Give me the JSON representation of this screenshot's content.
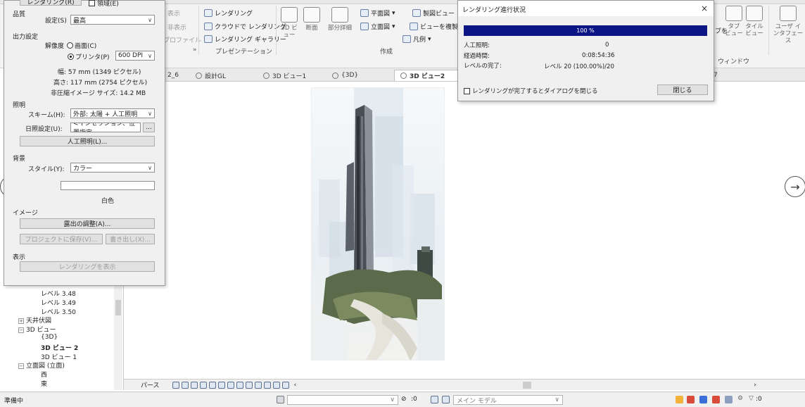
{
  "ribbon": {
    "items": [
      {
        "label": "レンダリング",
        "id": "rendering"
      },
      {
        "label": "クラウドで レンダリング",
        "id": "cloud-rendering"
      },
      {
        "label": "レンダリング ギャラリー",
        "id": "rendering-gallery"
      },
      {
        "label": "平面図",
        "id": "floor-plan"
      },
      {
        "label": "立面図",
        "id": "elevation"
      },
      {
        "label": "製図ビュー",
        "id": "drafting-view"
      },
      {
        "label": "ビューを複製",
        "id": "duplicate-view"
      },
      {
        "label": "凡例",
        "id": "legend"
      },
      {
        "label": "表示",
        "id": "show-dim"
      },
      {
        "label": "非表示",
        "id": "hide-dim"
      },
      {
        "label": "プロファイル",
        "id": "profile-dim"
      }
    ],
    "big_buttons": [
      {
        "label": "3D ビュー",
        "id": "3d-view"
      },
      {
        "label": "断面",
        "id": "section"
      },
      {
        "label": "部分詳細",
        "id": "callout"
      },
      {
        "label": "タブ ビュー",
        "id": "tab-views"
      },
      {
        "label": "タイル ビュー",
        "id": "tile-views"
      },
      {
        "label": "ユーザ インタフェース",
        "id": "user-interface"
      }
    ],
    "panels": {
      "presentation": "プレゼンテーション",
      "create": "作成",
      "window": "ウィンドウ"
    },
    "partial_left": "ブを"
  },
  "render_dialog": {
    "top_button": "レンダリング(R)",
    "region_checkbox": "領域(E)",
    "quality_group": "品質",
    "quality_label": "設定(S)",
    "quality_value": "最高",
    "output_group": "出力設定",
    "resolution_label": "解像度",
    "screen_option": "画面(C)",
    "printer_option": "プリンタ(P)",
    "dpi_value": "600 DPI",
    "width_label": "幅:",
    "width_value": "57 mm (1349 ピクセル)",
    "height_label": "高さ:",
    "height_value": "117 mm (2754 ピクセル)",
    "size_text": "非圧縮イメージ サイズ: 14.2 MB",
    "lighting_group": "照明",
    "scheme_label": "スキーム(H):",
    "scheme_value": "外部: 太陽 + 人工照明",
    "sun_label": "日照設定(U):",
    "sun_value": "<インセッション、位置指定",
    "sun_button": "...",
    "artificial_button": "人工照明(L)...",
    "background_group": "背景",
    "style_label": "スタイル(Y):",
    "style_value": "カラー",
    "color_name": "白色",
    "image_group": "イメージ",
    "exposure_button": "露出の調整(A)...",
    "save_button": "プロジェクトに保存(V)...",
    "export_button": "書き出し(X)...",
    "display_group": "表示",
    "show_button": "レンダリングを表示"
  },
  "progress_dialog": {
    "title": "レンダリング進行状況",
    "close": "×",
    "percent_text": "100 %",
    "percent": 100,
    "rows": [
      {
        "label": "人工照明:",
        "value": "0"
      },
      {
        "label": "経過時間:",
        "value": "0:08:54:36"
      },
      {
        "label": "レベルの完了:",
        "value": "レベル 20 (100.00%)/20"
      }
    ],
    "auto_close_label": "レンダリングが完了するとダイアログを閉じる",
    "close_button": "閉じる"
  },
  "view_tabs": [
    {
      "label": "2_6"
    },
    {
      "label": "設計GL"
    },
    {
      "label": "3D ビュー1"
    },
    {
      "label": "{3D}"
    },
    {
      "label": "3D ビュー2"
    },
    {
      "label": "7"
    }
  ],
  "browser": {
    "items": [
      {
        "label": "レベル 3.48",
        "indent": 2,
        "bold": false
      },
      {
        "label": "レベル 3.49",
        "indent": 2,
        "bold": false
      },
      {
        "label": "レベル 3.50",
        "indent": 2,
        "bold": false
      },
      {
        "label": "天井伏図",
        "indent": 1,
        "bold": false,
        "exp": "+"
      },
      {
        "label": "3D ビュー",
        "indent": 1,
        "bold": false,
        "exp": "−"
      },
      {
        "label": "{3D}",
        "indent": 2,
        "bold": false
      },
      {
        "label": "3D ビュー 2",
        "indent": 2,
        "bold": true
      },
      {
        "label": "3D ビュー 1",
        "indent": 2,
        "bold": false
      },
      {
        "label": "立面図 (立面)",
        "indent": 1,
        "bold": false,
        "exp": "−"
      },
      {
        "label": "西",
        "indent": 2,
        "bold": false
      },
      {
        "label": "東",
        "indent": 2,
        "bold": false
      }
    ]
  },
  "viewbar": {
    "label": "パース"
  },
  "status": {
    "ready": "準備中",
    "coord": ":0",
    "model": "メイン モデル",
    "filter_count": ":0"
  },
  "colors": {
    "progress": "#0b1684",
    "accent": "#6a7fa6"
  }
}
